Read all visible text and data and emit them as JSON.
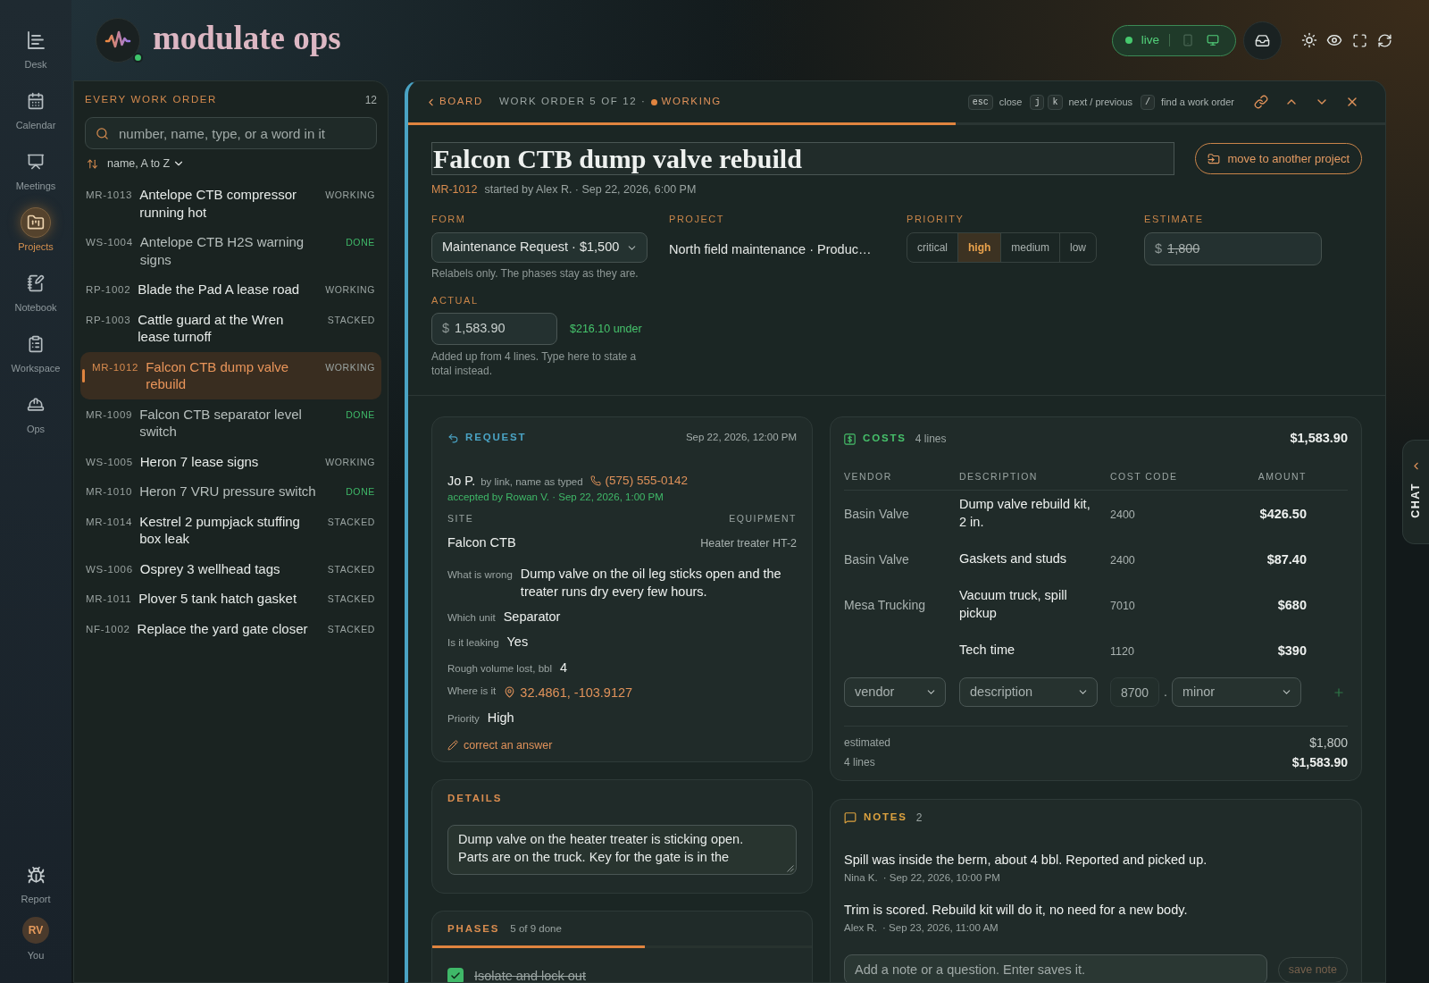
{
  "nav": {
    "items": [
      {
        "kind": "desk",
        "label": "Desk",
        "selected": false
      },
      {
        "kind": "calendar",
        "label": "Calendar",
        "selected": false
      },
      {
        "kind": "meetings",
        "label": "Meetings",
        "selected": false
      },
      {
        "kind": "projects",
        "label": "Projects",
        "selected": true
      },
      {
        "kind": "notebook",
        "label": "Notebook",
        "selected": false
      },
      {
        "kind": "workspace",
        "label": "Workspace",
        "selected": false
      },
      {
        "kind": "ops",
        "label": "Ops",
        "selected": false
      }
    ],
    "report": "Report",
    "user": {
      "initials": "RV",
      "label": "You"
    }
  },
  "header": {
    "title": "modulate ops",
    "online": true,
    "live": {
      "label": "live",
      "devices": [
        {
          "kind": "phone",
          "selected": false
        },
        {
          "kind": "desktop",
          "selected": true
        }
      ]
    }
  },
  "work_orders": {
    "title": "EVERY WORK ORDER",
    "count": "12",
    "search": {
      "placeholder": "number, name, type, or a word in it"
    },
    "sort": "name, A to Z",
    "items": [
      {
        "number": "MR-1013",
        "name": "Antelope CTB compressor running hot",
        "status": "WORKING",
        "kind": "working",
        "selected": false
      },
      {
        "number": "WS-1004",
        "name": "Antelope CTB H2S warning signs",
        "status": "DONE",
        "kind": "done",
        "selected": false
      },
      {
        "number": "RP-1002",
        "name": "Blade the Pad A lease road",
        "status": "WORKING",
        "kind": "working",
        "selected": false
      },
      {
        "number": "RP-1003",
        "name": "Cattle guard at the Wren lease turnoff",
        "status": "STACKED",
        "kind": "stacked",
        "selected": false
      },
      {
        "number": "MR-1012",
        "name": "Falcon CTB dump valve rebuild",
        "status": "WORKING",
        "kind": "working",
        "selected": true
      },
      {
        "number": "MR-1009",
        "name": "Falcon CTB separator level switch",
        "status": "DONE",
        "kind": "done",
        "selected": false
      },
      {
        "number": "WS-1005",
        "name": "Heron 7 lease signs",
        "status": "WORKING",
        "kind": "working",
        "selected": false
      },
      {
        "number": "MR-1010",
        "name": "Heron 7 VRU pressure switch",
        "status": "DONE",
        "kind": "done",
        "selected": false
      },
      {
        "number": "MR-1014",
        "name": "Kestrel 2 pumpjack stuffing box leak",
        "status": "STACKED",
        "kind": "stacked",
        "selected": false
      },
      {
        "number": "WS-1006",
        "name": "Osprey 3 wellhead tags",
        "status": "STACKED",
        "kind": "stacked",
        "selected": false
      },
      {
        "number": "MR-1011",
        "name": "Plover 5 tank hatch gasket",
        "status": "STACKED",
        "kind": "stacked",
        "selected": false
      },
      {
        "number": "NF-1002",
        "name": "Replace the yard gate closer",
        "status": "STACKED",
        "kind": "stacked",
        "selected": false
      }
    ]
  },
  "detail": {
    "back": "BOARD",
    "position": "WORK ORDER 5 OF 12 ·",
    "status": {
      "label": "WORKING",
      "kind": "working"
    },
    "shortcuts": [
      {
        "keys": [
          "esc"
        ],
        "label": "close"
      },
      {
        "keys": [
          "j",
          "k"
        ],
        "label": "next / previous"
      },
      {
        "keys": [
          "/"
        ],
        "label": "find a work order"
      }
    ],
    "progress": {
      "level": 0.56
    },
    "title": "Falcon CTB dump valve rebuild",
    "move_button": "move to another project",
    "number": "MR-1012",
    "started": "started by Alex R. · Sep 22, 2026, 6:00 PM",
    "form": {
      "label": "FORM",
      "value": "Maintenance Request · $1,500",
      "hint": "Relabels only. The phases stay as they are."
    },
    "actual": {
      "label": "ACTUAL",
      "currency": "$",
      "value": "1,583.90",
      "difference": "$216.10 under",
      "hint": "Added up from 4 lines. Type here to state a total instead."
    },
    "project": {
      "label": "PROJECT",
      "value": "North field maintenance · Produc…"
    },
    "priority": {
      "label": "PRIORITY",
      "options": [
        {
          "label": "critical",
          "selected": false
        },
        {
          "label": "high",
          "selected": true
        },
        {
          "label": "medium",
          "selected": false
        },
        {
          "label": "low",
          "selected": false
        }
      ]
    },
    "estimate": {
      "label": "ESTIMATE",
      "currency": "$",
      "value": "1,800",
      "struck": true
    },
    "request": {
      "title": "REQUEST",
      "time": "Sep 22, 2026, 12:00 PM",
      "requester": "Jo P.",
      "via": "by link, name as typed",
      "phone": "(575) 555-0142",
      "accepted": "accepted by Rowan V. · Sep 22, 2026, 1:00 PM",
      "site_label": "SITE",
      "equipment_label": "EQUIPMENT",
      "site": "Falcon CTB",
      "equipment": "Heater treater HT-2",
      "answers": [
        {
          "kind": "text",
          "question": "What is wrong",
          "answer": "Dump valve on the oil leg sticks open and the treater runs dry every few hours."
        },
        {
          "kind": "text",
          "question": "Which unit",
          "answer": "Separator"
        },
        {
          "kind": "text",
          "question": "Is it leaking",
          "answer": "Yes"
        },
        {
          "kind": "text",
          "question": "Rough volume lost, bbl",
          "answer": "4"
        },
        {
          "kind": "location",
          "question": "Where is it",
          "answer": "32.4861, -103.9127"
        },
        {
          "kind": "text",
          "question": "Priority",
          "answer": "High"
        }
      ],
      "correct_link": "correct an answer"
    },
    "details": {
      "title": "DETAILS",
      "text": "Dump valve on the heater treater is sticking open. Parts are on the truck. Key for the gate is in the"
    },
    "phases": {
      "title": "PHASES",
      "summary": "5 of 9 done",
      "level": 0.56,
      "items": [
        {
          "label": "Isolate and lock out",
          "checked": true
        }
      ]
    },
    "costs": {
      "title": "COSTS",
      "count": "4 lines",
      "total": "$1,583.90",
      "columns": [
        "VENDOR",
        "DESCRIPTION",
        "COST CODE",
        "AMOUNT"
      ],
      "rows": [
        {
          "vendor": "Basin Valve",
          "description": "Dump valve rebuild kit, 2 in.",
          "cost_code": "2400",
          "amount": "$426.50"
        },
        {
          "vendor": "Basin Valve",
          "description": "Gaskets and studs",
          "cost_code": "2400",
          "amount": "$87.40"
        },
        {
          "vendor": "Mesa Trucking",
          "description": "Vacuum truck, spill pickup",
          "cost_code": "7010",
          "amount": "$680"
        },
        {
          "description": "Tech time",
          "cost_code": "1120",
          "amount": "$390"
        }
      ],
      "new_line": {
        "vendor": {
          "placeholder": "vendor"
        },
        "description": {
          "placeholder": "description"
        },
        "cost_code": {
          "placeholder": "8700"
        },
        "separator": ".",
        "minor": {
          "placeholder": "minor"
        }
      },
      "totals": [
        {
          "label": "estimated",
          "value": "$1,800"
        },
        {
          "label": "4 lines",
          "value": "$1,583.90"
        }
      ]
    },
    "notes": {
      "title": "NOTES",
      "count": "2",
      "items": [
        {
          "text": "Spill was inside the berm, about 4 bbl. Reported and picked up.",
          "author": "Nina K.",
          "time": "· Sep 22, 2026, 10:00 PM"
        },
        {
          "text": "Trim is scored. Rebuild kit will do it, no need for a new body.",
          "author": "Alex R.",
          "time": "· Sep 23, 2026, 11:00 AM"
        }
      ],
      "input": {
        "placeholder": "Add a note or a question. Enter saves it."
      },
      "save_button": {
        "label": "save note",
        "disabled": true
      }
    }
  },
  "chat": {
    "label": "CHAT"
  }
}
